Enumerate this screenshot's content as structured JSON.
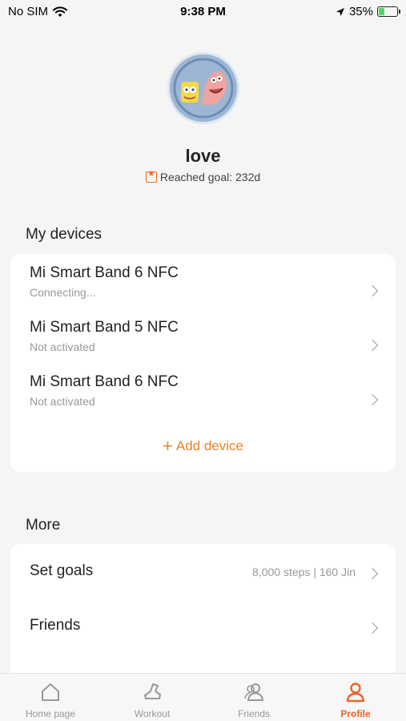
{
  "status_bar": {
    "carrier": "No SIM",
    "time": "9:38 PM",
    "battery": "35%",
    "battery_level": 0.35
  },
  "profile": {
    "username": "love",
    "goal_text": "Reached goal: 232d"
  },
  "devices_section": {
    "title": "My devices",
    "items": [
      {
        "name": "Mi Smart Band 6 NFC",
        "status": "Connecting..."
      },
      {
        "name": "Mi Smart Band 5 NFC",
        "status": "Not activated"
      },
      {
        "name": "Mi Smart Band 6 NFC",
        "status": "Not activated"
      }
    ],
    "add_label": "Add device"
  },
  "more_section": {
    "title": "More",
    "items": [
      {
        "label": "Set goals",
        "value": "8,000 steps | 160 Jin"
      },
      {
        "label": "Friends",
        "value": ""
      }
    ]
  },
  "tab_bar": {
    "tabs": [
      {
        "label": "Home page",
        "icon": "home-icon"
      },
      {
        "label": "Workout",
        "icon": "shoe-icon"
      },
      {
        "label": "Friends",
        "icon": "friends-icon"
      },
      {
        "label": "Profile",
        "icon": "profile-icon"
      }
    ],
    "active": "Profile"
  },
  "colors": {
    "accent": "#e8632a",
    "add_device": "#e8832a",
    "background": "#f5f5f5",
    "card": "#ffffff"
  }
}
